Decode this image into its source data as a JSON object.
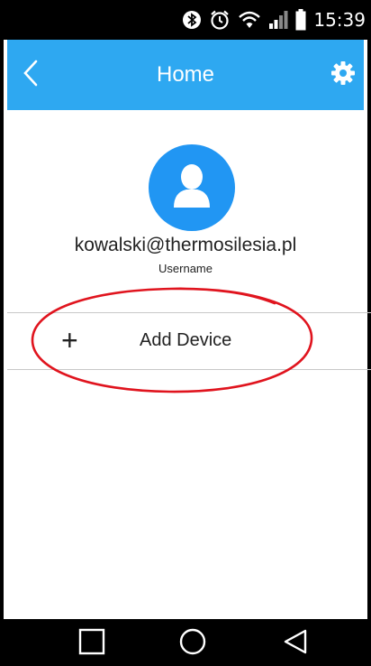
{
  "status_bar": {
    "time": "15:39",
    "icons": [
      "bluetooth-icon",
      "alarm-icon",
      "wifi-icon",
      "signal-icon",
      "battery-icon"
    ]
  },
  "app_bar": {
    "title": "Home",
    "back_icon": "chevron-left-icon",
    "settings_icon": "gear-icon",
    "color": "#2ea8f1"
  },
  "profile": {
    "avatar_icon": "person-icon",
    "avatar_color": "#2196f3",
    "email": "kowalski@thermosilesia.pl",
    "label": "Username"
  },
  "actions": {
    "add_device_icon": "plus-icon",
    "add_device_label": "Add Device"
  },
  "annotation": {
    "shape": "ellipse",
    "color": "#e0141e"
  },
  "nav_bar": {
    "buttons": [
      "recent-apps-icon",
      "home-icon",
      "back-triangle-icon"
    ]
  }
}
